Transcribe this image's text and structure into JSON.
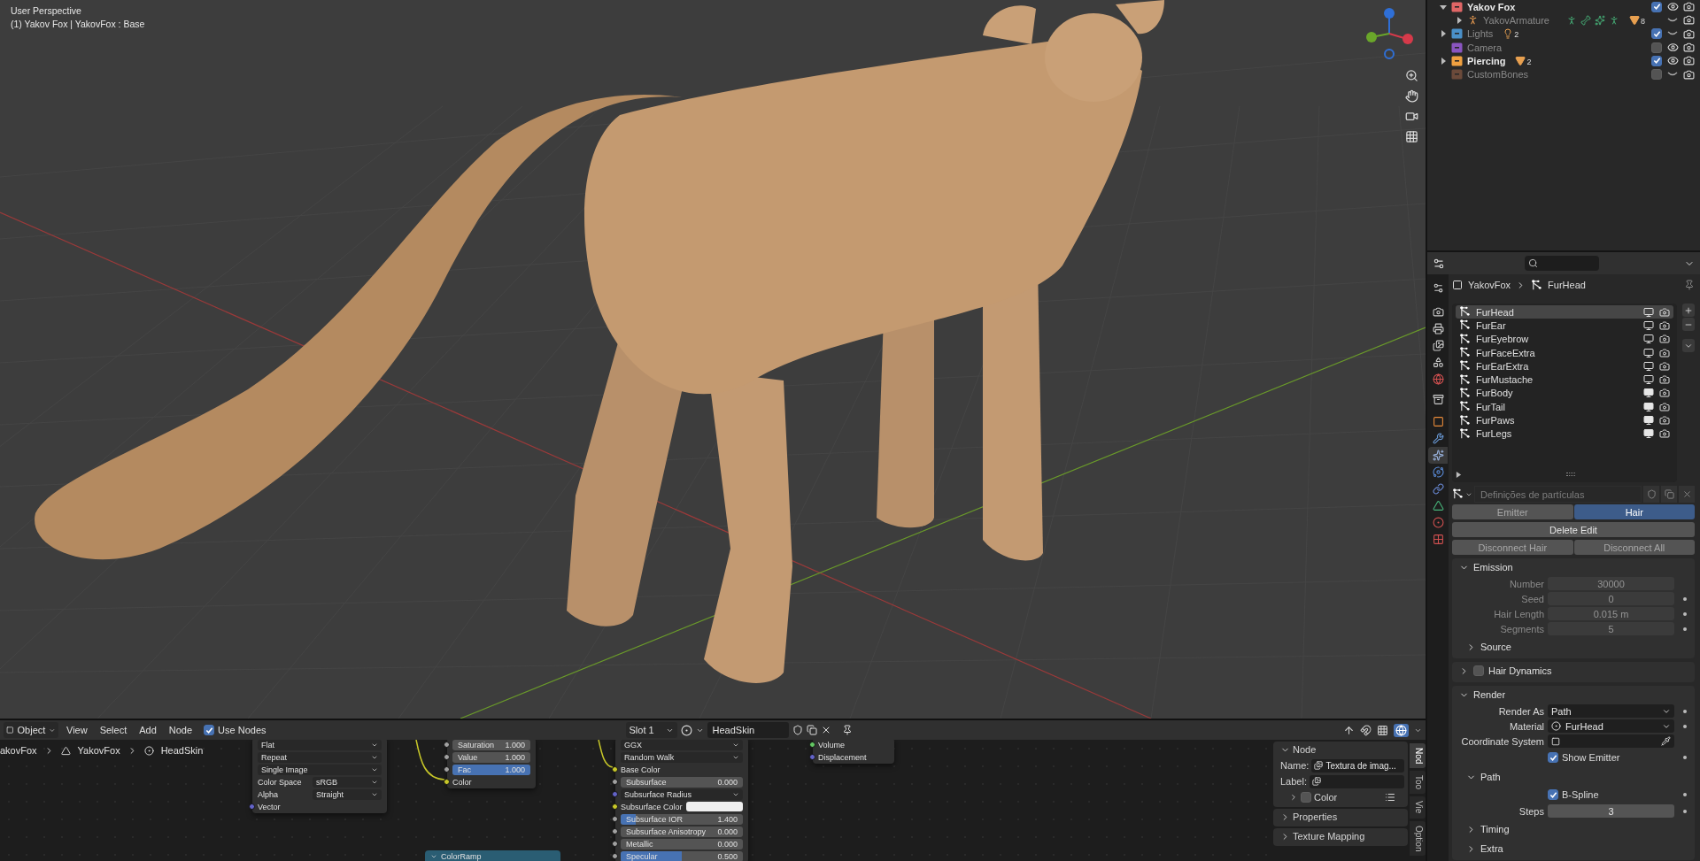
{
  "viewport": {
    "view_name": "User Perspective",
    "object_info": "(1) Yakov Fox | YakovFox : Base"
  },
  "outliner": {
    "items": [
      {
        "name": "Yakov Fox",
        "kind": "collection",
        "color": "#e06666",
        "expanded": true,
        "checked": true,
        "visible": true,
        "children": [
          {
            "name": "YakovArmature",
            "kind": "armature",
            "expanded": false,
            "visible": false,
            "badge": {
              "kind": "mesh",
              "count": "8"
            }
          }
        ]
      },
      {
        "name": "Lights",
        "kind": "collection",
        "color": "#4a90c8",
        "expanded": false,
        "checked": true,
        "visible": false,
        "badge": {
          "kind": "light",
          "count": "2"
        }
      },
      {
        "name": "Camera",
        "kind": "collection",
        "color": "#8a55c0",
        "checked": false,
        "visible": true
      },
      {
        "name": "Piercing",
        "kind": "collection",
        "color": "#f0a040",
        "expanded": false,
        "checked": true,
        "visible": true,
        "badge": {
          "kind": "mesh",
          "count": "2"
        }
      },
      {
        "name": "CustomBones",
        "kind": "collection",
        "color": "#6b4a3a",
        "checked": false,
        "visible": false
      }
    ]
  },
  "properties": {
    "tabs": [
      {
        "kind": "tool",
        "selected": false
      },
      {
        "kind": "render",
        "selected": false
      },
      {
        "kind": "output",
        "selected": false
      },
      {
        "kind": "view_layer",
        "selected": false
      },
      {
        "kind": "scene",
        "selected": false
      },
      {
        "kind": "world",
        "selected": false
      },
      {
        "kind": "collection",
        "selected": false
      },
      {
        "kind": "object",
        "selected": false
      },
      {
        "kind": "modifiers",
        "selected": false
      },
      {
        "kind": "particles",
        "selected": true
      },
      {
        "kind": "physics",
        "selected": false
      },
      {
        "kind": "constraints",
        "selected": false
      },
      {
        "kind": "data",
        "selected": false
      },
      {
        "kind": "material",
        "selected": false
      },
      {
        "kind": "texture",
        "selected": false
      }
    ],
    "breadcrumb": [
      "YakovFox",
      "FurHead"
    ],
    "particle_systems": [
      {
        "name": "FurHead",
        "selected": true,
        "show_viewport": false
      },
      {
        "name": "FurEar",
        "selected": false,
        "show_viewport": false
      },
      {
        "name": "FurEyebrow",
        "selected": false,
        "show_viewport": false
      },
      {
        "name": "FurFaceExtra",
        "selected": false,
        "show_viewport": false
      },
      {
        "name": "FurEarExtra",
        "selected": false,
        "show_viewport": false
      },
      {
        "name": "FurMustache",
        "selected": false,
        "show_viewport": false
      },
      {
        "name": "FurBody",
        "selected": false,
        "show_viewport": true
      },
      {
        "name": "FurTail",
        "selected": false,
        "show_viewport": true
      },
      {
        "name": "FurPaws",
        "selected": false,
        "show_viewport": true
      },
      {
        "name": "FurLegs",
        "selected": false,
        "show_viewport": true
      }
    ],
    "settings_name": "Definições de partículas",
    "type_tabs": [
      {
        "label": "Emitter",
        "selected": false
      },
      {
        "label": "Hair",
        "selected": true
      }
    ],
    "delete_edit": "Delete Edit",
    "disconnect": [
      "Disconnect Hair",
      "Disconnect All"
    ],
    "panels": [
      {
        "title": "Emission",
        "expanded": true,
        "fields": [
          {
            "kind": "number",
            "label": "Number",
            "value": "30000",
            "disabled": true,
            "keyframe_dot": false
          },
          {
            "kind": "number",
            "label": "Seed",
            "value": "0",
            "disabled": true,
            "keyframe_dot": true
          },
          {
            "kind": "number",
            "label": "Hair Length",
            "value": "0.015 m",
            "disabled": true,
            "keyframe_dot": true
          },
          {
            "kind": "number",
            "label": "Segments",
            "value": "5",
            "disabled": true,
            "keyframe_dot": true
          }
        ],
        "subpanels": [
          {
            "title": "Source",
            "expanded": false
          }
        ]
      },
      {
        "title": "Hair Dynamics",
        "expanded": false,
        "checked": false
      },
      {
        "title": "Render",
        "expanded": true,
        "fields": [
          {
            "kind": "dropdown",
            "label": "Render As",
            "value": "Path",
            "disabled": false,
            "keyframe_dot": true
          },
          {
            "kind": "material",
            "label": "Material",
            "value": "FurHead",
            "disabled": false,
            "keyframe_dot": true
          },
          {
            "kind": "object",
            "label": "Coordinate System",
            "disabled": false,
            "keyframe_dot": false
          },
          {
            "kind": "checkbox",
            "label": "Show Emitter",
            "checked": true,
            "disabled": false,
            "keyframe_dot": true
          }
        ],
        "subpanels": [
          {
            "title": "Path",
            "expanded": true,
            "fields": [
              {
                "kind": "checkbox",
                "label": "B-Spline",
                "checked": true,
                "disabled": false,
                "keyframe_dot": true
              },
              {
                "kind": "number",
                "label": "Steps",
                "value": "3",
                "disabled": false,
                "keyframe_dot": true
              }
            ]
          },
          {
            "title": "Timing",
            "expanded": false
          },
          {
            "title": "Extra",
            "expanded": false
          }
        ]
      }
    ]
  },
  "node_editor": {
    "header": {
      "mode": "Object",
      "menus": [
        "View",
        "Select",
        "Add",
        "Node"
      ],
      "use_nodes": {
        "label": "Use Nodes",
        "checked": true
      },
      "slot": "Slot 1",
      "material": "HeadSkin"
    },
    "breadcrumb": [
      "akovFox",
      "YakovFox",
      "HeadSkin"
    ],
    "nodes": [
      {
        "kind": "body",
        "rows": [
          {
            "kind": "dropdown",
            "value": "Flat"
          },
          {
            "kind": "dropdown",
            "value": "Repeat"
          },
          {
            "kind": "dropdown",
            "value": "Single Image"
          },
          {
            "kind": "labeled_dropdown",
            "label": "Color Space",
            "value": "sRGB"
          },
          {
            "kind": "labeled_dropdown",
            "label": "Alpha",
            "value": "Straight"
          },
          {
            "kind": "socket",
            "label": "Vector",
            "color": "#6363c7"
          }
        ]
      },
      {
        "kind": "body",
        "rows": [
          {
            "kind": "number",
            "label": "Saturation",
            "value": "1.000",
            "color": "#a1a1a1"
          },
          {
            "kind": "number",
            "label": "Value",
            "value": "1.000",
            "color": "#a1a1a1"
          },
          {
            "kind": "slider",
            "label": "Fac",
            "value": "1.000",
            "level": 1,
            "color": "#a1a1a1"
          },
          {
            "kind": "socket",
            "label": "Color",
            "color": "#c7c729"
          }
        ]
      },
      {
        "kind": "body",
        "rows": [
          {
            "kind": "dropdown",
            "value": "GGX"
          },
          {
            "kind": "dropdown",
            "value": "Random Walk"
          },
          {
            "kind": "socket",
            "label": "Base Color",
            "color": "#c7c729"
          },
          {
            "kind": "number",
            "label": "Subsurface",
            "value": "0.000",
            "color": "#a1a1a1"
          },
          {
            "kind": "socket_dropdown",
            "label": "Subsurface Radius",
            "color": "#6363c7"
          },
          {
            "kind": "color_swatch",
            "label": "Subsurface Color",
            "color": "#c7c729"
          },
          {
            "kind": "slider",
            "label": "Subsurface IOR",
            "value": "1.400",
            "level": 0.12,
            "color": "#a1a1a1"
          },
          {
            "kind": "number",
            "label": "Subsurface Anisotropy",
            "value": "0.000",
            "color": "#a1a1a1"
          },
          {
            "kind": "number",
            "label": "Metallic",
            "value": "0.000",
            "color": "#a1a1a1"
          },
          {
            "kind": "slider",
            "label": "Specular",
            "value": "0.500",
            "level": 0.5,
            "color": "#a1a1a1"
          }
        ]
      },
      {
        "kind": "body",
        "rows": [
          {
            "kind": "socket",
            "label": "Volume",
            "color": "#63c763"
          },
          {
            "kind": "socket",
            "label": "Displacement",
            "color": "#6363c7"
          }
        ]
      },
      {
        "kind": "header_only",
        "title": "ColorRamp"
      }
    ],
    "sidebar": {
      "node_panel": {
        "title": "Node",
        "expanded": true,
        "name_label": "Name:",
        "name_value": "Textura de imag...",
        "label_label": "Label:",
        "color_label": "Color",
        "color_expanded": false,
        "color_checked": false
      },
      "panels": [
        {
          "title": "Properties",
          "expanded": false
        },
        {
          "title": "Texture Mapping",
          "expanded": false
        }
      ],
      "tabs": [
        {
          "label": "Nod",
          "selected": true
        },
        {
          "label": "Too",
          "selected": false
        },
        {
          "label": "Vie",
          "selected": false
        },
        {
          "label": "Option",
          "selected": false
        }
      ]
    }
  }
}
